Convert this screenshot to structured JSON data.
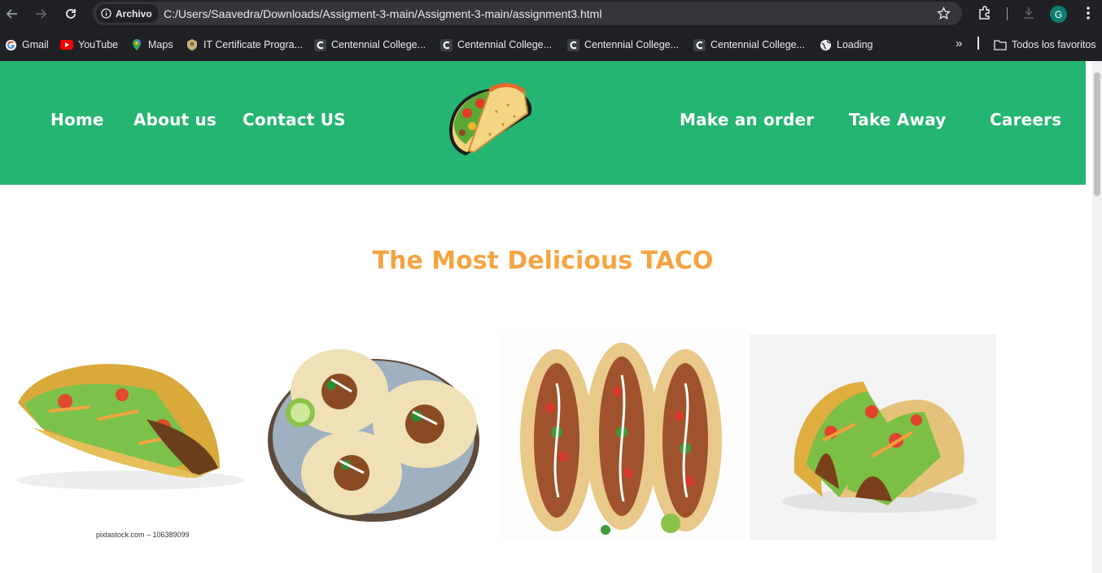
{
  "browser": {
    "chip_label": "Archivo",
    "url": "C:/Users/Saavedra/Downloads/Assigment-3-main/Assigment-3-main/assignment3.html",
    "profile_initial": "G",
    "bookmarks": [
      {
        "label": "Gmail",
        "icon": "google-icon"
      },
      {
        "label": "YouTube",
        "icon": "youtube-icon"
      },
      {
        "label": "Maps",
        "icon": "maps-icon"
      },
      {
        "label": "IT Certificate Progra...",
        "icon": "certificate-icon"
      },
      {
        "label": "Centennial College...",
        "icon": "centennial-icon"
      },
      {
        "label": "Centennial College...",
        "icon": "centennial-icon"
      },
      {
        "label": "Centennial College...",
        "icon": "centennial-icon"
      },
      {
        "label": "Centennial College...",
        "icon": "centennial-icon"
      },
      {
        "label": "Loading",
        "icon": "globe-icon"
      }
    ],
    "overflow_label": "»",
    "all_bookmarks": "Todos los favoritos"
  },
  "site": {
    "nav_left": [
      "Home",
      "About us",
      "Contact US"
    ],
    "nav_right": [
      "Make an order",
      "Take Away",
      "Careers"
    ],
    "heading": "The Most Delicious TACO",
    "photo_watermark": "pixtastock.com – 106389099"
  },
  "colors": {
    "header_green": "#24b572",
    "heading_orange": "#f5a442",
    "chrome_dark": "#202124"
  }
}
